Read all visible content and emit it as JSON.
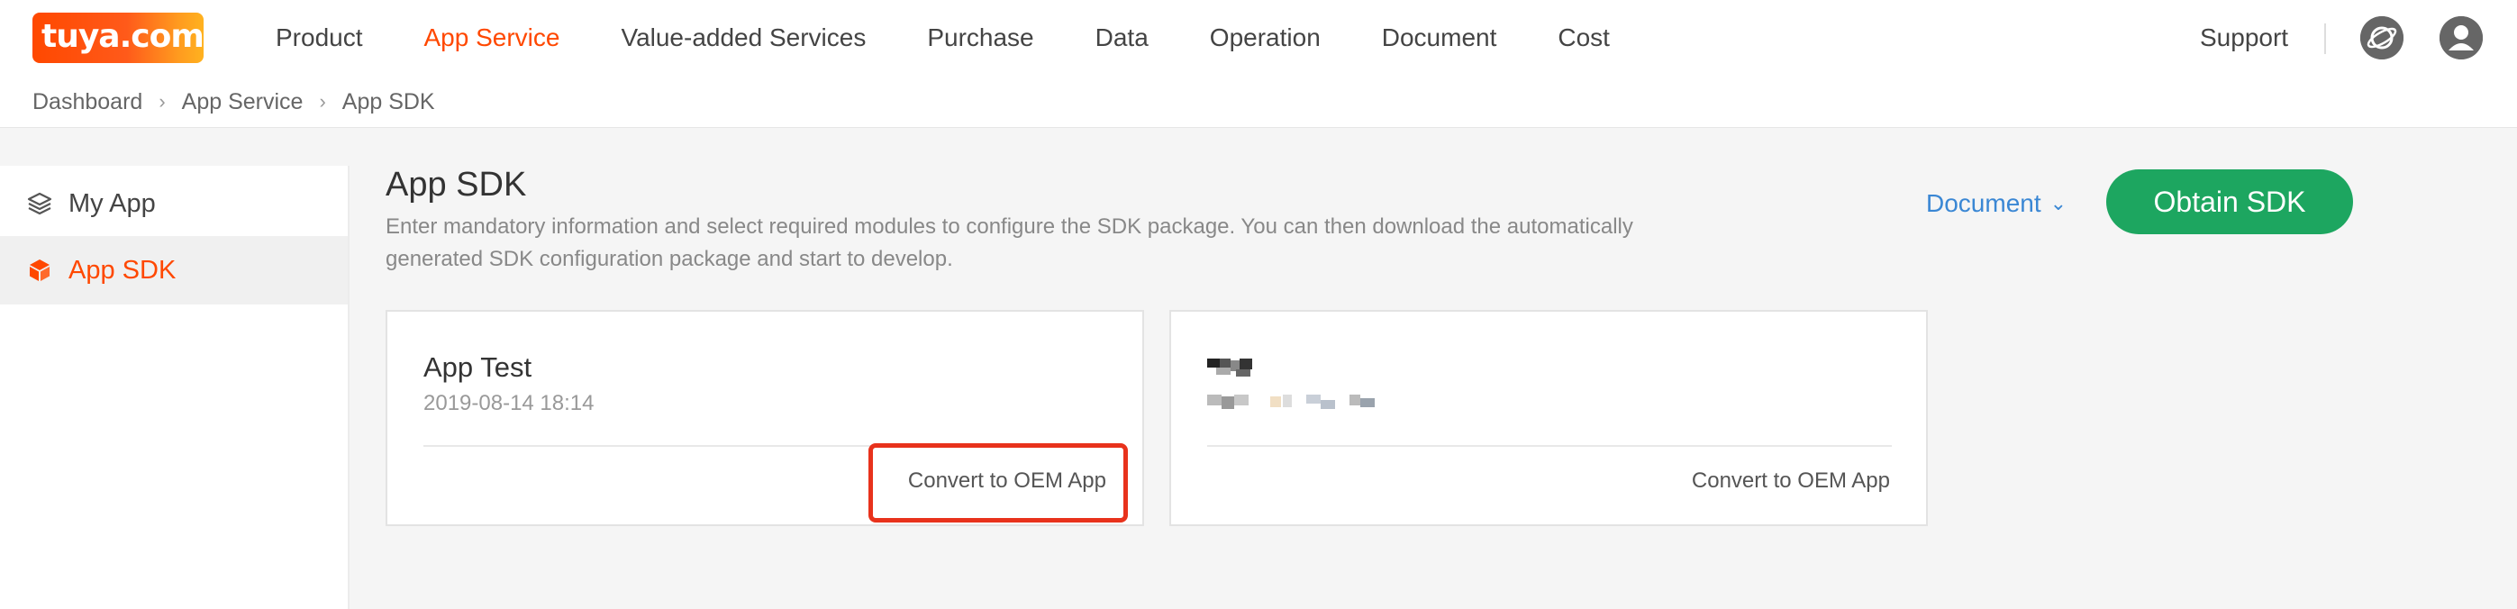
{
  "header": {
    "logo": "tuya.com",
    "nav": [
      "Product",
      "App Service",
      "Value-added Services",
      "Purchase",
      "Data",
      "Operation",
      "Document",
      "Cost"
    ],
    "active_nav": "App Service",
    "support": "Support",
    "icons": [
      "globe-icon",
      "user-icon"
    ]
  },
  "breadcrumb": [
    "Dashboard",
    "App Service",
    "App SDK"
  ],
  "sidebar": {
    "items": [
      {
        "label": "My App",
        "icon": "layers-icon"
      },
      {
        "label": "App SDK",
        "icon": "cube-icon"
      }
    ],
    "active": "App SDK"
  },
  "main": {
    "title": "App SDK",
    "description": "Enter mandatory information and select required modules to configure the SDK package. You can then download the automatically generated SDK configuration package and start to develop.",
    "document_link": "Document",
    "obtain_button": "Obtain SDK",
    "cards": [
      {
        "title": "App Test",
        "date": "2019-08-14 18:14",
        "action": "Convert to OEM App"
      },
      {
        "action": "Convert to OEM App"
      }
    ]
  },
  "colors": {
    "accent": "#ff4800",
    "primary_button": "#1da660",
    "link": "#3a87d4",
    "highlight": "#e8321c"
  }
}
